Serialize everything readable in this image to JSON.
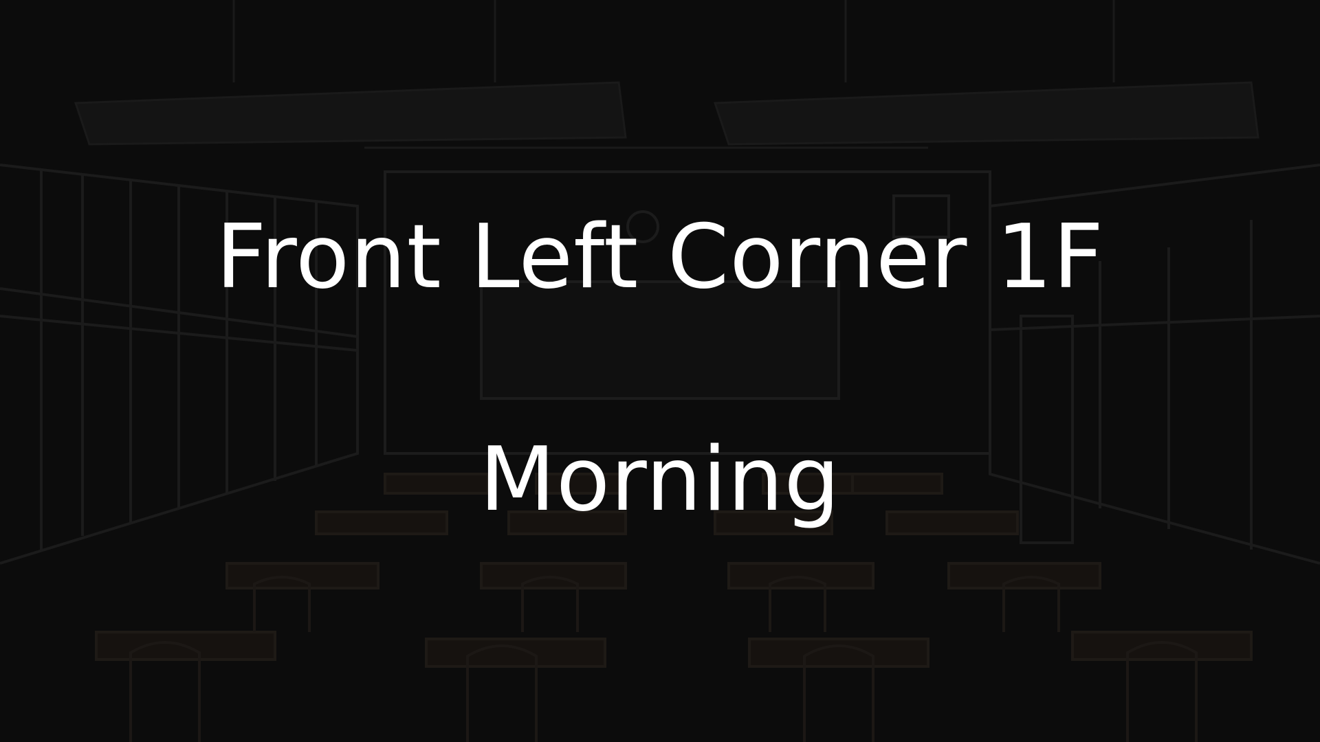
{
  "scene": {
    "background": "dark-classroom",
    "location": "Front Left Corner 1F",
    "time_of_day": "Morning"
  },
  "colors": {
    "text": "#ffffff",
    "background": "#0b0b0b",
    "overlay": "#000000"
  }
}
